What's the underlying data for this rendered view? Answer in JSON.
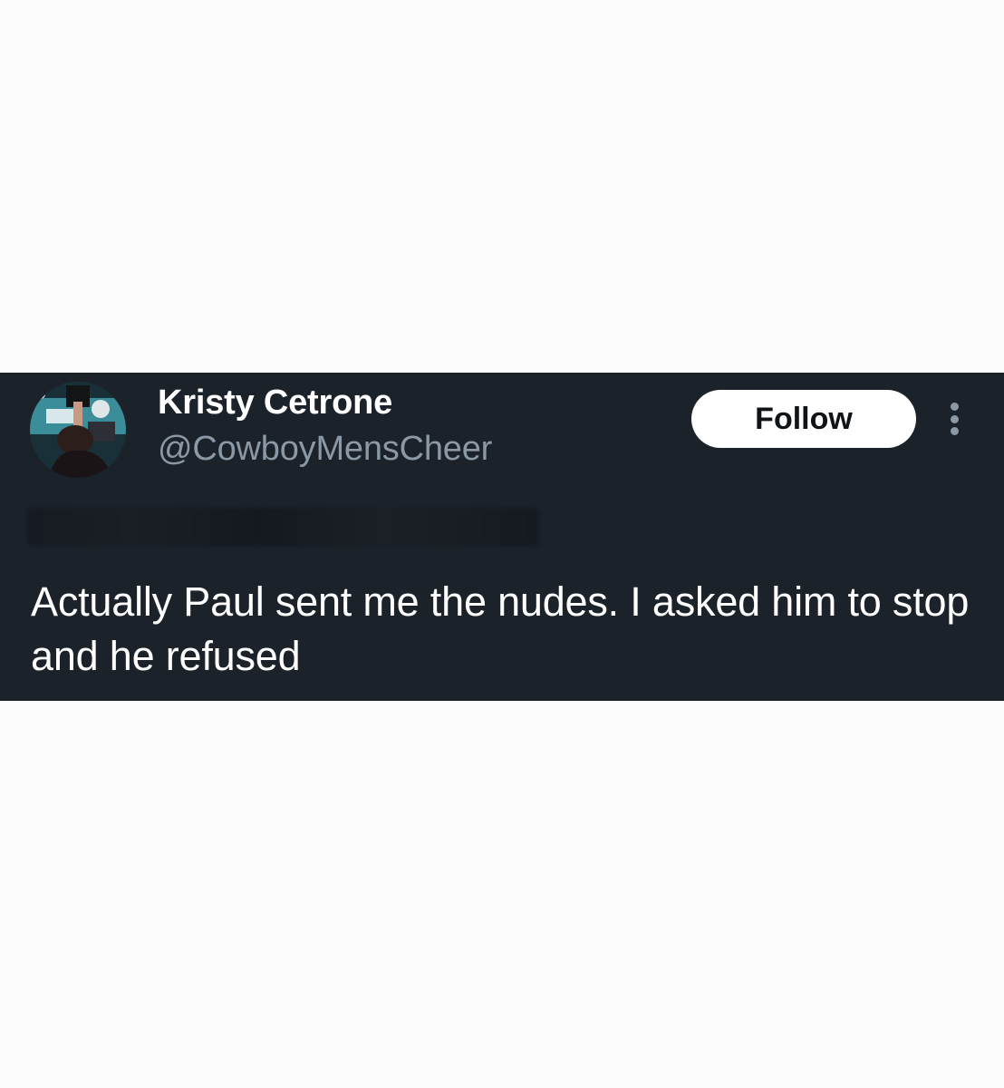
{
  "tweet": {
    "author": {
      "display_name": "Kristy Cetrone",
      "handle": "@CowboyMensCheer"
    },
    "follow_label": "Follow",
    "text": "Actually Paul sent me the nudes. I asked him to stop and he refused"
  },
  "colors": {
    "card_background": "#1c222a",
    "page_background": "#fcfcfc",
    "handle_gray": "#8b98a5",
    "follow_button_bg": "#ffffff"
  },
  "icons": {
    "more": "more-dots-vertical-icon"
  }
}
